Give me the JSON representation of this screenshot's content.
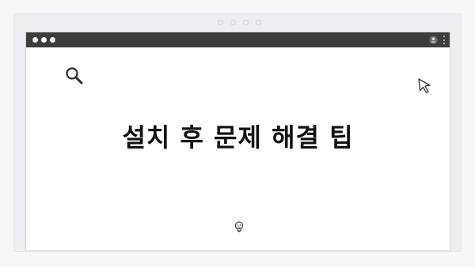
{
  "page": {
    "heading": "설치 후 문제 해결 팁"
  },
  "window": {
    "titlebar_controls": [
      "window-dot",
      "window-dot",
      "window-dot"
    ]
  },
  "icons": {
    "search": "search-icon",
    "cursor": "cursor-arrow-icon",
    "profile": "profile-icon",
    "menu": "more-vertical-icon",
    "bulb": "lightbulb-icon"
  },
  "colors": {
    "titlebar": "#3d3d3d",
    "background": "#f6f7f9",
    "window": "#ffffff",
    "heading": "#111111"
  }
}
